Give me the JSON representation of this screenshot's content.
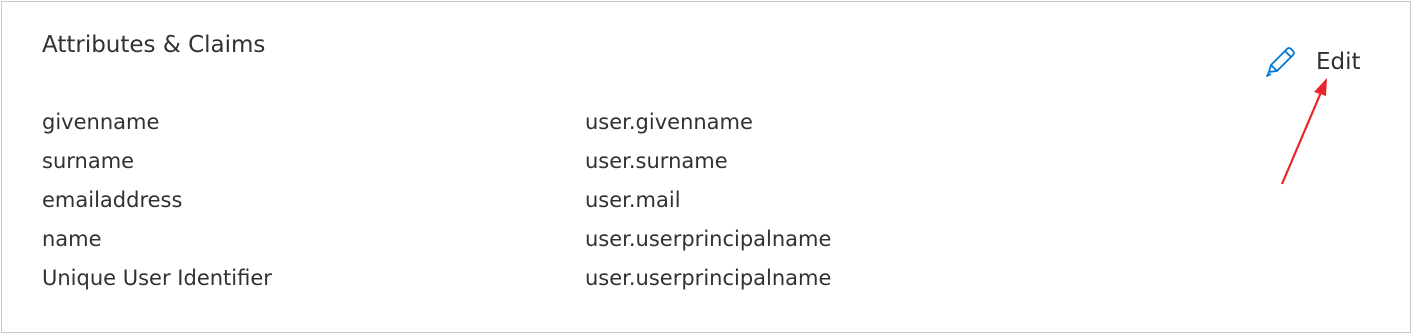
{
  "section": {
    "title": "Attributes & Claims",
    "edit_label": "Edit"
  },
  "claims": [
    {
      "name": "givenname",
      "value": "user.givenname"
    },
    {
      "name": "surname",
      "value": "user.surname"
    },
    {
      "name": "emailaddress",
      "value": "user.mail"
    },
    {
      "name": "name",
      "value": "user.userprincipalname"
    },
    {
      "name": "Unique User Identifier",
      "value": "user.userprincipalname"
    }
  ],
  "colors": {
    "text": "#323130",
    "icon": "#0078d4",
    "border": "#c8c8c8",
    "annotation_arrow": "#e8262a"
  },
  "icons": {
    "edit": "pencil-icon"
  }
}
